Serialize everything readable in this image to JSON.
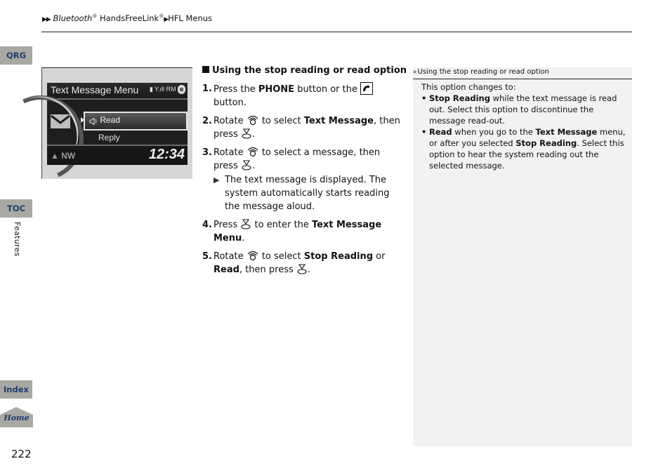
{
  "breadcrumb": {
    "prefix": "▶▶",
    "part1": "Bluetooth",
    "reg1": "®",
    "part2": " HandsFreeLink",
    "reg2": "®",
    "sep": "▶",
    "part3": "HFL Menus"
  },
  "side_tabs": {
    "qrg": "QRG",
    "toc": "TOC",
    "section": "Features",
    "index": "Index",
    "home": "Home"
  },
  "page_number": "222",
  "screen": {
    "title": "Text Message Menu",
    "status": "▮ Y.ıll RM",
    "bluetooth": "ʙ",
    "items": [
      "Read",
      "Reply"
    ],
    "read_icon": "speaker-icon",
    "compass": "▲ NW",
    "clock": "12:34"
  },
  "steps": {
    "section_title": "Using the stop reading or read option",
    "items": [
      {
        "num": "1.",
        "pre": "Press the ",
        "bold": "PHONE",
        "post": " button or the ",
        "post2": " button."
      },
      {
        "num": "2.",
        "pre": "Rotate ",
        "mid": " to select ",
        "bold": "Text Message",
        "post": ", then press ",
        "end": "."
      },
      {
        "num": "3.",
        "pre": "Rotate ",
        "mid": " to select a message, then press ",
        "end": ".",
        "sub": "The text message is displayed. The system automatically starts reading the message aloud."
      },
      {
        "num": "4.",
        "pre": "Press ",
        "mid": " to enter the ",
        "bold": "Text Message Menu",
        "end": "."
      },
      {
        "num": "5.",
        "pre": "Rotate ",
        "mid": " to select ",
        "bold": "Stop Reading",
        "or": " or ",
        "bold2": "Read",
        "comma": ",",
        "post": " then press ",
        "end": "."
      }
    ]
  },
  "notes": {
    "header_icon": "»",
    "header": "Using the stop reading or read option",
    "intro": "This option changes to:",
    "bullets": [
      {
        "bold": "Stop Reading",
        "text": " while the text message is read out. Select this option to discontinue the message read-out."
      },
      {
        "bold": "Read",
        "text1": " when you go to the ",
        "bold2": "Text Message",
        "text2": " menu, or after you selected ",
        "bold3": "Stop Reading",
        "text3": ". Select this option to hear the system reading out the selected message."
      }
    ]
  }
}
